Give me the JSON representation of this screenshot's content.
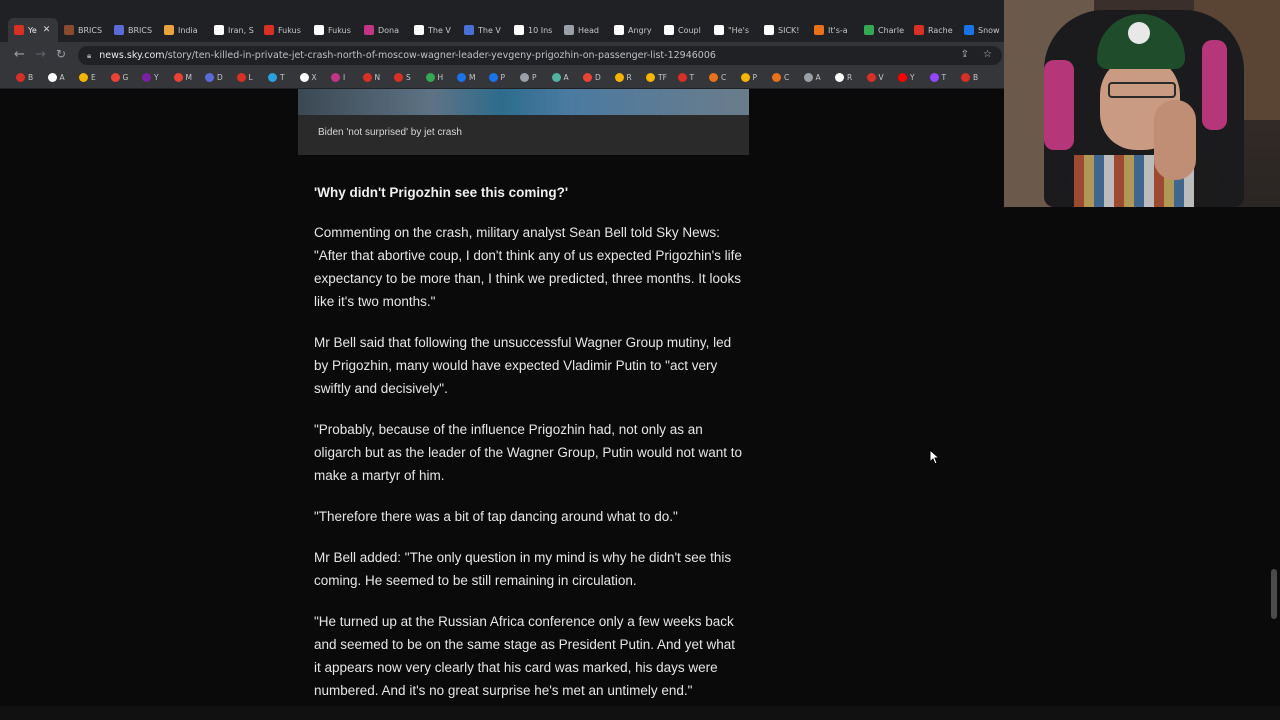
{
  "browser": {
    "tabs": [
      {
        "label": "Ye",
        "color": "#d93025",
        "active": true
      },
      {
        "label": "BRICS",
        "color": "#8a4b2b"
      },
      {
        "label": "BRICS",
        "color": "#5b6bd6"
      },
      {
        "label": "India",
        "color": "#e8a33d"
      },
      {
        "label": "Iran, S",
        "color": "#ffffff"
      },
      {
        "label": "Fukus",
        "color": "#d93025"
      },
      {
        "label": "Fukus",
        "color": "#ffffff"
      },
      {
        "label": "Dona",
        "color": "#c13584"
      },
      {
        "label": "The V",
        "color": "#ffffff"
      },
      {
        "label": "The V",
        "color": "#4a6fd6"
      },
      {
        "label": "10 Ins",
        "color": "#ffffff"
      },
      {
        "label": "Head",
        "color": "#9aa0a6"
      },
      {
        "label": "Angry",
        "color": "#ffffff"
      },
      {
        "label": "Coupl",
        "color": "#ffffff"
      },
      {
        "label": "\"He's",
        "color": "#ffffff"
      },
      {
        "label": "SICK!",
        "color": "#ffffff"
      },
      {
        "label": "It's-a",
        "color": "#e8711a"
      },
      {
        "label": "Charle",
        "color": "#34a853"
      },
      {
        "label": "Rache",
        "color": "#d93025"
      },
      {
        "label": "Snow",
        "color": "#1a73e8"
      }
    ],
    "tab_close": "✕",
    "url_domain": "news.sky.com",
    "url_path": "/story/ten-killed-in-private-jet-crash-north-of-moscow-wagner-leader-yevgeny-prigozhin-on-passenger-list-12946006",
    "bookmarks": [
      {
        "label": "B",
        "color": "#d93025"
      },
      {
        "label": "A",
        "color": "#ffffff"
      },
      {
        "label": "E",
        "color": "#f4b400"
      },
      {
        "label": "G",
        "color": "#ea4335"
      },
      {
        "label": "Y",
        "color": "#7b1fa2"
      },
      {
        "label": "M",
        "color": "#ea4335"
      },
      {
        "label": "D",
        "color": "#5b6bd6"
      },
      {
        "label": "L",
        "color": "#d93025"
      },
      {
        "label": "T",
        "color": "#2aa1de"
      },
      {
        "label": "X",
        "color": "#ffffff"
      },
      {
        "label": "I",
        "color": "#c13584"
      },
      {
        "label": "N",
        "color": "#d93025"
      },
      {
        "label": "S",
        "color": "#d93025"
      },
      {
        "label": "H",
        "color": "#34a853"
      },
      {
        "label": "M",
        "color": "#1a73e8"
      },
      {
        "label": "P",
        "color": "#1a73e8"
      },
      {
        "label": "P",
        "color": "#9aa0a6"
      },
      {
        "label": "A",
        "color": "#4fb3a0"
      },
      {
        "label": "D",
        "color": "#ea4335"
      },
      {
        "label": "R",
        "color": "#f4b400"
      },
      {
        "label": "TF",
        "color": "#f4b400"
      },
      {
        "label": "T",
        "color": "#d93025"
      },
      {
        "label": "C",
        "color": "#e8711a"
      },
      {
        "label": "P",
        "color": "#f4b400"
      },
      {
        "label": "C",
        "color": "#e8711a"
      },
      {
        "label": "A",
        "color": "#9aa0a6"
      },
      {
        "label": "R",
        "color": "#ffffff"
      },
      {
        "label": "V",
        "color": "#d93025"
      },
      {
        "label": "Y",
        "color": "#ff0000"
      },
      {
        "label": "T",
        "color": "#9146ff"
      },
      {
        "label": "B",
        "color": "#d93025"
      }
    ]
  },
  "article": {
    "image_caption": "Biden 'not surprised' by jet crash",
    "subheading": "'Why didn't Prigozhin see this coming?'",
    "paragraphs": [
      "Commenting on the crash, military analyst Sean Bell told Sky News: \"After that abortive coup, I don't think any of us expected Prigozhin's life expectancy to be more than, I think we predicted, three months. It looks like it's two months.\"",
      "Mr Bell said that following the unsuccessful Wagner Group mutiny, led by Prigozhin, many would have expected Vladimir Putin to \"act very swiftly and decisively\".",
      "\"Probably, because of the influence Prigozhin had, not only as an oligarch but as the leader of the Wagner Group, Putin would not want to make a martyr of him.",
      "\"Therefore there was a bit of tap dancing around what to do.\"",
      "Mr Bell added: \"The only question in my mind is why he didn't see this coming. He seemed to be still remaining in circulation.",
      "\"He turned up at the Russian Africa conference only a few weeks back and seemed to be on the same stage as President Putin. And yet what it appears now very clearly that his card was marked, his days were numbered. And it's no great surprise he's met an untimely end.\""
    ]
  }
}
